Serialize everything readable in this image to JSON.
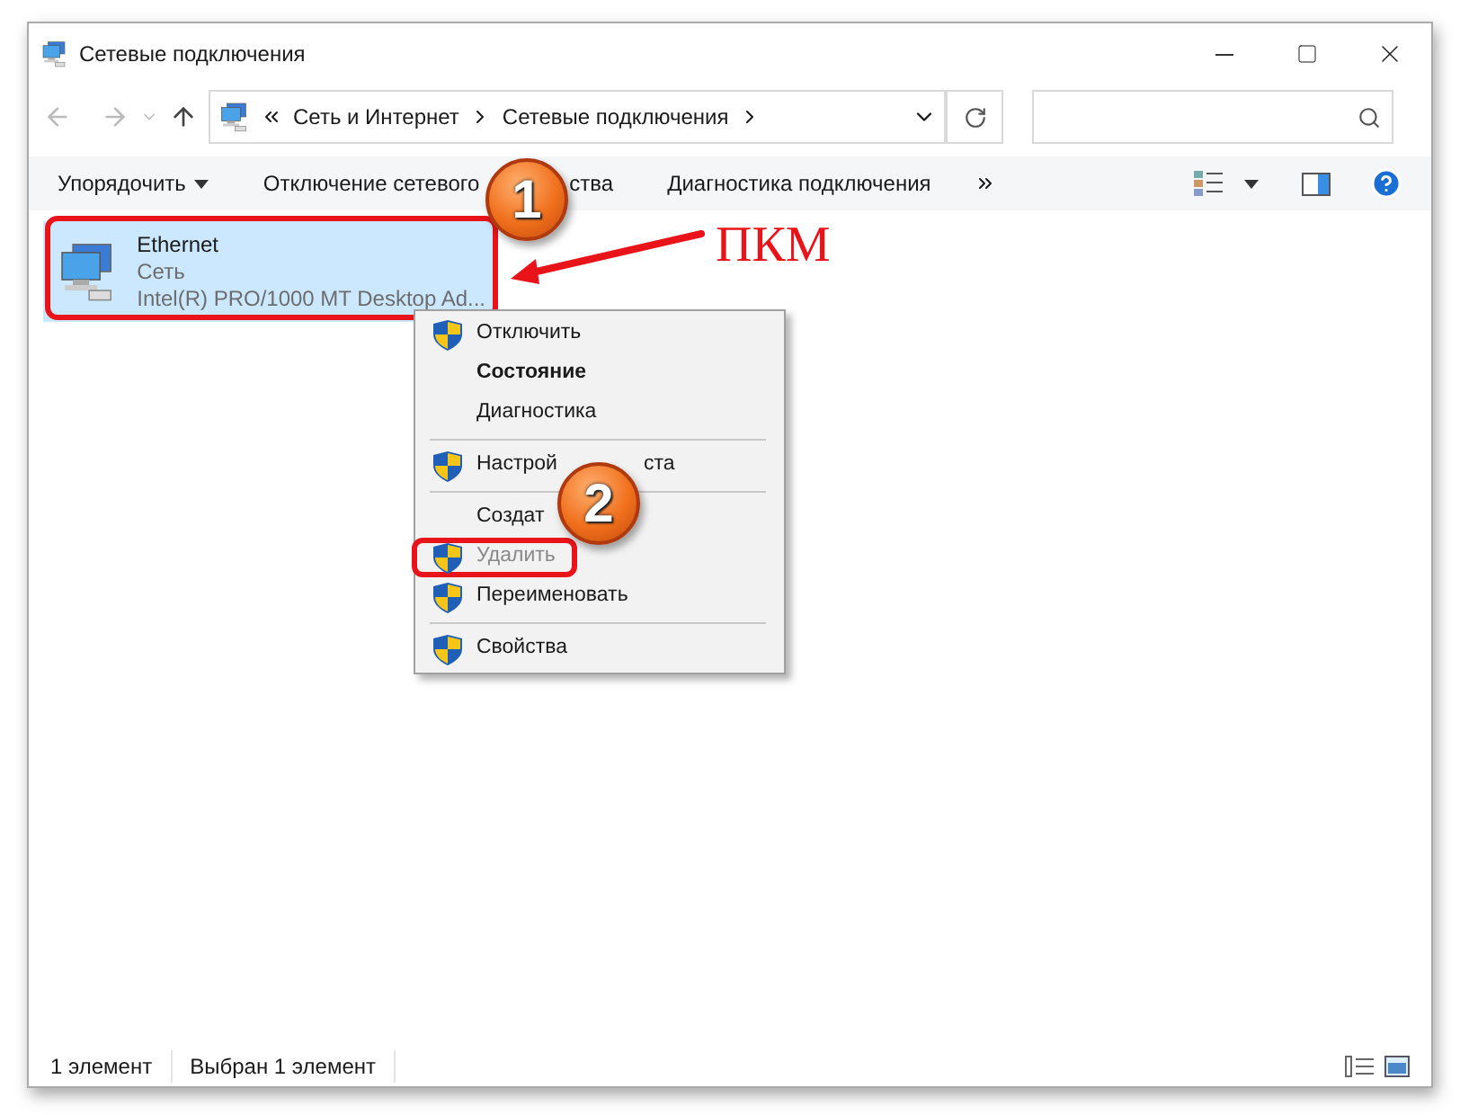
{
  "window": {
    "title": "Сетевые подключения"
  },
  "address": {
    "breadcrumbs": [
      "Сеть и Интернет",
      "Сетевые подключения"
    ]
  },
  "toolbar": [
    {
      "label_parts": [
        "Упорядочить"
      ],
      "dropdown": true
    },
    {
      "label_parts": [
        "Отключение сетевого",
        "ства"
      ],
      "dropdown": false
    },
    {
      "label_parts": [
        "Диагностика подключения"
      ],
      "dropdown": false
    }
  ],
  "connection": {
    "name": "Ethernet",
    "type": "Сеть",
    "adapter": "Intel(R) PRO/1000 MT Desktop Ad...",
    "selected": true
  },
  "annotation": {
    "label": "ПКМ",
    "badges": [
      "1",
      "2"
    ]
  },
  "context_menu": [
    {
      "kind": "item",
      "label_parts": [
        "Отключить"
      ],
      "shield": true,
      "bold": false,
      "disabled": false,
      "highlighted": false
    },
    {
      "kind": "item",
      "label_parts": [
        "Состояние"
      ],
      "shield": false,
      "bold": true,
      "disabled": false,
      "highlighted": false
    },
    {
      "kind": "item",
      "label_parts": [
        "Диагностика"
      ],
      "shield": false,
      "bold": false,
      "disabled": false,
      "highlighted": false
    },
    {
      "kind": "separator"
    },
    {
      "kind": "item",
      "label_parts": [
        "Настрой",
        "ста"
      ],
      "shield": true,
      "bold": false,
      "disabled": false,
      "highlighted": false
    },
    {
      "kind": "separator"
    },
    {
      "kind": "item",
      "label_parts": [
        "Создат"
      ],
      "shield": false,
      "bold": false,
      "disabled": false,
      "highlighted": false
    },
    {
      "kind": "item",
      "label_parts": [
        "Удалить"
      ],
      "shield": true,
      "bold": false,
      "disabled": true,
      "highlighted": true
    },
    {
      "kind": "item",
      "label_parts": [
        "Переименовать"
      ],
      "shield": true,
      "bold": false,
      "disabled": false,
      "highlighted": false
    },
    {
      "kind": "separator"
    },
    {
      "kind": "item",
      "label_parts": [
        "Свойства"
      ],
      "shield": true,
      "bold": false,
      "disabled": false,
      "highlighted": false
    }
  ],
  "status_bar": [
    "1 элемент",
    "Выбран 1 элемент"
  ]
}
